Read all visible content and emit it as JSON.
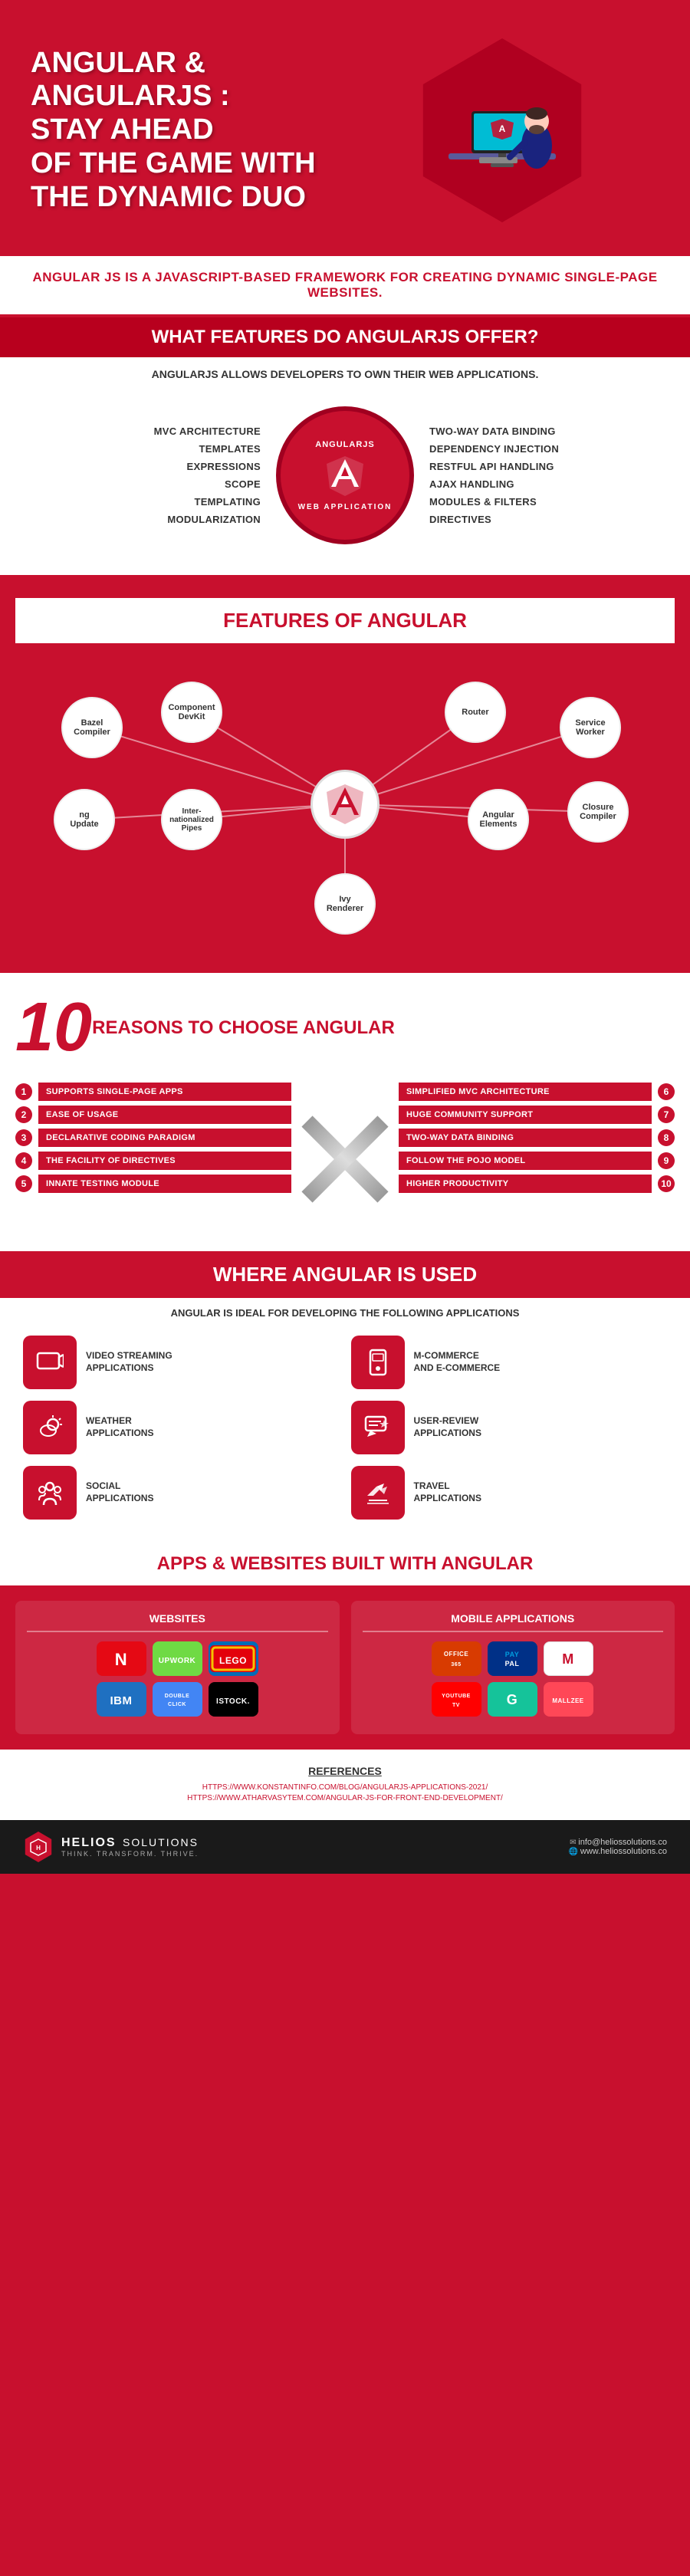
{
  "header": {
    "title_line1": "ANGULAR &",
    "title_line2": "ANGULARJS :",
    "title_line3": "STAY AHEAD",
    "title_line4": "OF THE GAME WITH",
    "title_line5": "THE DYNAMIC DUO"
  },
  "intro": {
    "text": "ANGULAR JS IS A JAVASCRIPT-BASED FRAMEWORK FOR CREATING DYNAMIC SINGLE-PAGE WEBSITES."
  },
  "features_angularjs": {
    "section_title": "WHAT FEATURES DO ANGULARJS OFFER?",
    "description": "ANGULARJS ALLOWS DEVELOPERS TO OWN THEIR WEB APPLICATIONS.",
    "circle_label_top": "ANGULARJS",
    "circle_label_bottom": "WEB APPLICATION",
    "left_features": [
      "MVC ARCHITECTURE",
      "TEMPLATES",
      "EXPRESSIONS",
      "SCOPE",
      "TEMPLATING",
      "MODULARIZATION"
    ],
    "right_features": [
      "TWO-WAY DATA BINDING",
      "DEPENDENCY INJECTION",
      "RESTFUL API HANDLING",
      "AJAX HANDLING",
      "MODULES & FILTERS",
      "DIRECTIVES"
    ]
  },
  "features_angular": {
    "section_title": "FEATURES OF ANGULAR",
    "nodes": [
      {
        "label": "Bazel\nCompiler",
        "pos": "tl"
      },
      {
        "label": "Component\nDevKit",
        "pos": "tc"
      },
      {
        "label": "Router",
        "pos": "tr"
      },
      {
        "label": "Service\nWorker",
        "pos": "tr2"
      },
      {
        "label": "ng\nUpdate",
        "pos": "ml"
      },
      {
        "label": "Inter-\nnationalized\nPipes",
        "pos": "mc"
      },
      {
        "label": "Angular\nElements",
        "pos": "mr"
      },
      {
        "label": "Closure\nCompiler",
        "pos": "mr2"
      },
      {
        "label": "Ivy\nRenderer",
        "pos": "bc"
      }
    ]
  },
  "reasons": {
    "section_label": "REASONS TO CHOOSE ANGULAR",
    "number": "10",
    "left_items": [
      {
        "num": "1",
        "text": "SUPPORTS SINGLE-PAGE APPS"
      },
      {
        "num": "2",
        "text": "EASE OF USAGE"
      },
      {
        "num": "3",
        "text": "DECLARATIVE CODING PARADIGM"
      },
      {
        "num": "4",
        "text": "THE FACILITY OF DIRECTIVES"
      },
      {
        "num": "5",
        "text": "INNATE TESTING MODULE"
      }
    ],
    "right_items": [
      {
        "num": "6",
        "text": "SIMPLIFIED MVC ARCHITECTURE"
      },
      {
        "num": "7",
        "text": "HUGE COMMUNITY SUPPORT"
      },
      {
        "num": "8",
        "text": "TWO-WAY DATA BINDING"
      },
      {
        "num": "9",
        "text": "FOLLOW THE POJO MODEL"
      },
      {
        "num": "10",
        "text": "HIGHER PRODUCTIVITY"
      }
    ]
  },
  "where_used": {
    "section_title": "WHERE ANGULAR IS USED",
    "description": "ANGULAR IS IDEAL FOR DEVELOPING THE FOLLOWING APPLICATIONS",
    "cases": [
      {
        "label": "VIDEO STREAMING\nAPPLICATIONS",
        "icon": "📹"
      },
      {
        "label": "M-COMMERCE\nAND E-COMMERCE",
        "icon": "📱"
      },
      {
        "label": "WEATHER\nAPPLICATIONS",
        "icon": "🌤️"
      },
      {
        "label": "USER-REVIEW\nAPPLICATIONS",
        "icon": "💬"
      },
      {
        "label": "SOCIAL\nAPPLICATIONS",
        "icon": "👥"
      },
      {
        "label": "TRAVEL\nAPPLICATIONS",
        "icon": "✈️"
      }
    ]
  },
  "apps": {
    "section_title": "APPS & WEBSITES BUILT WITH ANGULAR",
    "websites_title": "WEBSITES",
    "mobile_title": "MOBILE APPLICATIONS",
    "websites_row1": [
      "N",
      "Upwork",
      "LEGO"
    ],
    "websites_row2": [
      "IBM",
      "DoubleClick",
      "iStock."
    ],
    "mobile_row1": [
      "Office",
      "PayPal",
      "M"
    ],
    "mobile_row2": [
      "YouTube",
      "G",
      "mallzee"
    ]
  },
  "references": {
    "title": "REFERENCES",
    "links": [
      "HTTPS://WWW.KONSTANTINFO.COM/BLOG/ANGULARJS-APPLICATIONS-2021/",
      "HTTPS://WWW.ATHARVASYTEM.COM/ANGULAR-JS-FOR-FRONT-END-DEVELOPMENT/"
    ]
  },
  "footer": {
    "company": "HELIOS",
    "company_sub": "SOLUTIONS",
    "tagline": "THINK. TRANSFORM. THRIVE.",
    "email": "info@heliossolutions.co",
    "website": "www.heliossolutions.co"
  }
}
